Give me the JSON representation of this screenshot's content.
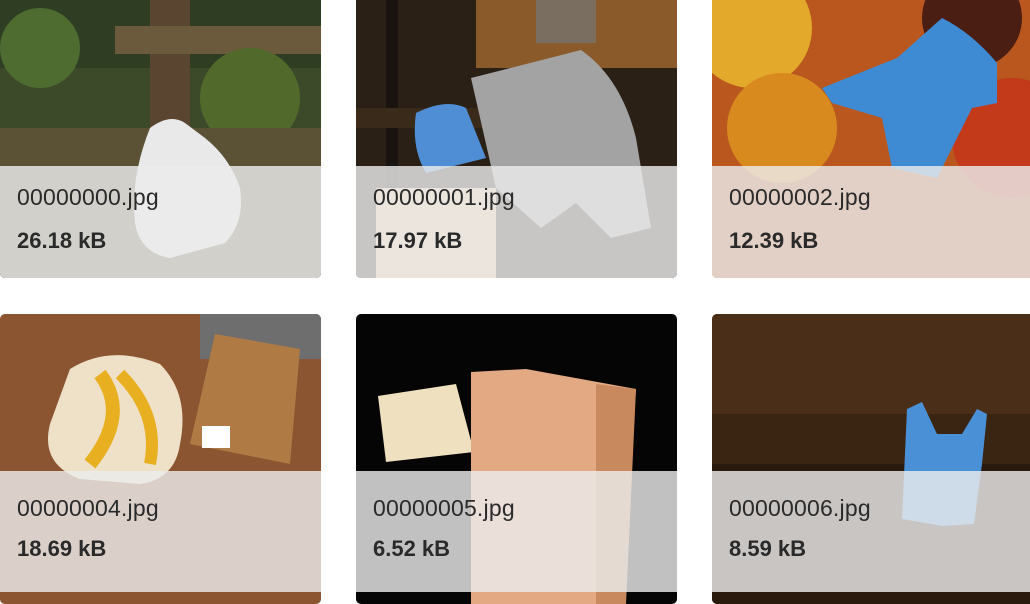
{
  "gallery": {
    "items": [
      {
        "filename": "00000000.jpg",
        "size": "26.18 kB",
        "thumb_icon": "white-plastic-bag-in-forest"
      },
      {
        "filename": "00000001.jpg",
        "size": "17.97 kB",
        "thumb_icon": "plastic-bags-on-wooden-shelf"
      },
      {
        "filename": "00000002.jpg",
        "size": "12.39 kB",
        "thumb_icon": "blue-plastic-bag-on-autumn-leaves"
      },
      {
        "filename": "00000004.jpg",
        "size": "18.69 kB",
        "thumb_icon": "crumpled-paper-and-paper-bag-on-wood"
      },
      {
        "filename": "00000005.jpg",
        "size": "6.52 kB",
        "thumb_icon": "paper-bags-on-black"
      },
      {
        "filename": "00000006.jpg",
        "size": "8.59 kB",
        "thumb_icon": "blue-plastic-bag-on-dark-ground"
      }
    ]
  }
}
